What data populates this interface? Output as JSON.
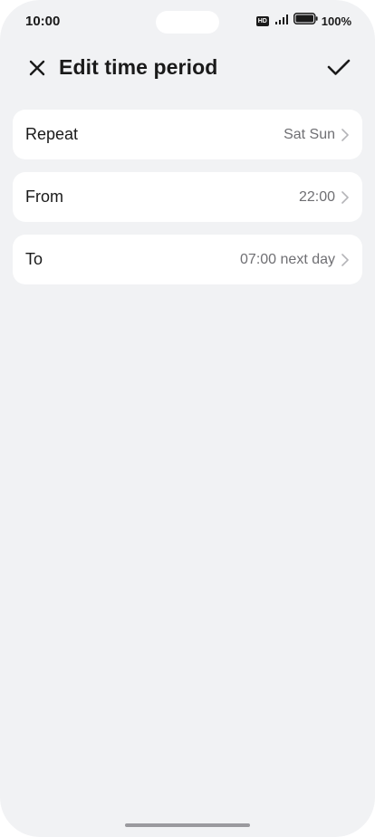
{
  "status_bar": {
    "time": "10:00",
    "hd": "HD",
    "battery": "100%"
  },
  "header": {
    "title": "Edit time period",
    "close_icon": "close-icon",
    "confirm_icon": "checkmark-icon"
  },
  "rows": [
    {
      "label": "Repeat",
      "value": "Sat Sun"
    },
    {
      "label": "From",
      "value": "22:00"
    },
    {
      "label": "To",
      "value": "07:00 next day"
    }
  ],
  "colors": {
    "background": "#f1f2f4",
    "card": "#ffffff",
    "text_primary": "#1a1a1a",
    "text_secondary": "#6f6f73"
  }
}
